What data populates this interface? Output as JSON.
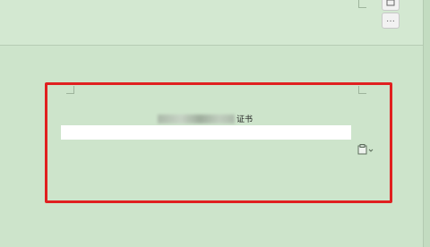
{
  "toolbar": {
    "top_icon": "layout-icon",
    "more_label": "···"
  },
  "document": {
    "title_visible_text": "证书",
    "blurred_prefix_note": ""
  },
  "paste_options": {
    "icon": "paste-options-icon"
  },
  "colors": {
    "page_background": "#cde4cb",
    "highlight_border": "#e02020"
  }
}
